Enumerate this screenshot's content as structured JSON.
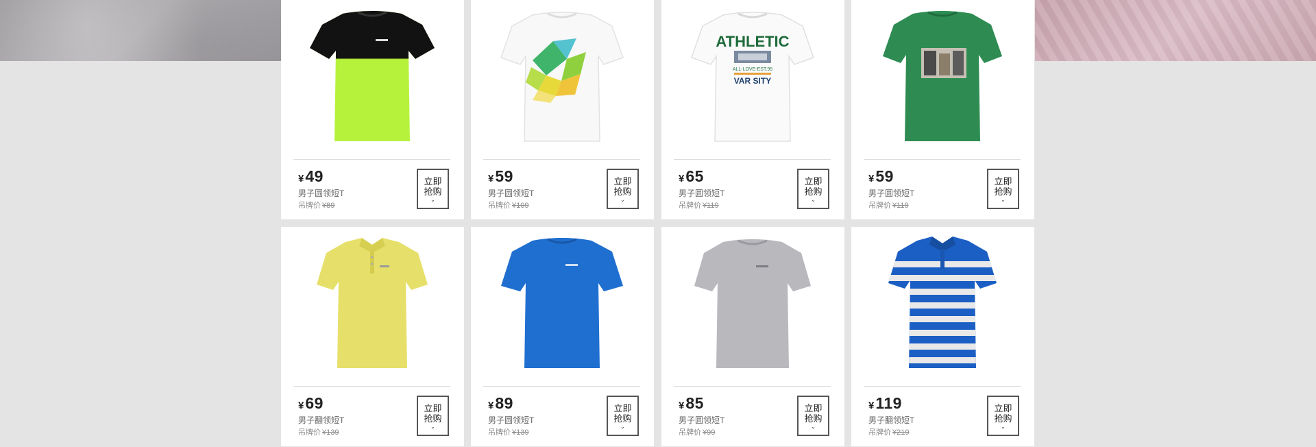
{
  "products": [
    {
      "price": "49",
      "name": "男子圆领短T",
      "tag_label": "吊牌价",
      "original": "89",
      "buy_line1": "立即",
      "buy_line2": "抢购",
      "image": "tshirt-black-lime"
    },
    {
      "price": "59",
      "name": "男子圆领短T",
      "tag_label": "吊牌价",
      "original": "109",
      "buy_line1": "立即",
      "buy_line2": "抢购",
      "image": "tshirt-white-geometric"
    },
    {
      "price": "65",
      "name": "男子圆领短T",
      "tag_label": "吊牌价",
      "original": "119",
      "buy_line1": "立即",
      "buy_line2": "抢购",
      "image": "tshirt-white-athletic"
    },
    {
      "price": "59",
      "name": "男子圆领短T",
      "tag_label": "吊牌价",
      "original": "119",
      "buy_line1": "立即",
      "buy_line2": "抢购",
      "image": "tshirt-green-print"
    },
    {
      "price": "69",
      "name": "男子翻领短T",
      "tag_label": "吊牌价",
      "original": "139",
      "buy_line1": "立即",
      "buy_line2": "抢购",
      "image": "polo-yellow"
    },
    {
      "price": "89",
      "name": "男子圆领短T",
      "tag_label": "吊牌价",
      "original": "139",
      "buy_line1": "立即",
      "buy_line2": "抢购",
      "image": "tshirt-blue"
    },
    {
      "price": "85",
      "name": "男子圆领短T",
      "tag_label": "吊牌价",
      "original": "99",
      "buy_line1": "立即",
      "buy_line2": "抢购",
      "image": "tshirt-grey"
    },
    {
      "price": "119",
      "name": "男子翻领短T",
      "tag_label": "吊牌价",
      "original": "219",
      "buy_line1": "立即",
      "buy_line2": "抢购",
      "image": "polo-blue-stripe"
    }
  ],
  "currency": "¥",
  "athletic_print": {
    "top": "ATHLETIC",
    "mid": "ALL-LOVE-EST.95",
    "bottom": "VAR SITY"
  }
}
